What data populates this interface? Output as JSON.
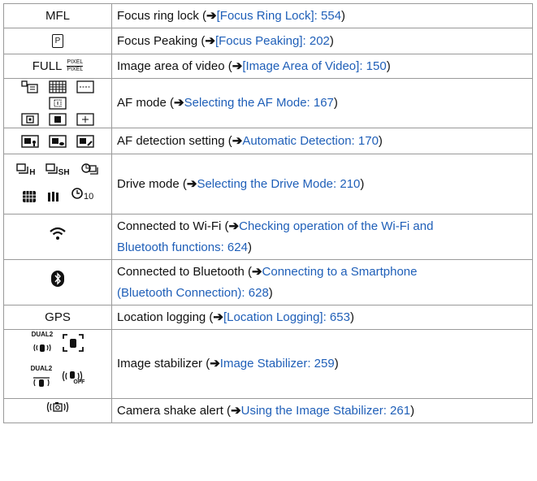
{
  "rows": [
    {
      "icon": "MFL",
      "prefix": "Focus ring lock (",
      "link": "[Focus Ring Lock]: 554",
      "suffix": ")"
    },
    {
      "icon": "P",
      "prefix": "Focus Peaking (",
      "link": "[Focus Peaking]: 202",
      "suffix": ")"
    },
    {
      "icon": "FULL",
      "icon_frac_top": "PIXEL",
      "icon_frac_bottom": "PIXEL",
      "prefix": "Image area of video (",
      "link": "[Image Area of Video]: 150",
      "suffix": ")"
    },
    {
      "prefix": "AF mode (",
      "link": "Selecting the AF Mode: 167",
      "suffix": ")"
    },
    {
      "prefix": "AF detection setting (",
      "link": "Automatic Detection: 170",
      "suffix": ")"
    },
    {
      "icon_line1": [
        "H",
        "SH",
        ""
      ],
      "icon_line2": [
        "",
        "",
        "10"
      ],
      "prefix": "Drive mode (",
      "link": "Selecting the Drive Mode: 210",
      "suffix": ")"
    },
    {
      "prefix": "Connected to Wi-Fi (",
      "link_line1": "Checking operation of the Wi-Fi and",
      "link_line2": "Bluetooth functions: 624",
      "suffix": ")"
    },
    {
      "prefix": "Connected to Bluetooth (",
      "link_line1": "Connecting to a Smartphone",
      "link_line2": "(Bluetooth Connection): 628",
      "suffix": ")"
    },
    {
      "icon": "GPS",
      "prefix": "Location logging (",
      "link": "[Location Logging]: 653",
      "suffix": ")"
    },
    {
      "icon_dual_1": "DUAL2",
      "icon_dual_2": "DUAL2",
      "icon_off": "OFF",
      "prefix": "Image stabilizer (",
      "link": "Image Stabilizer: 259",
      "suffix": ")"
    },
    {
      "prefix": "Camera shake alert (",
      "link": "Using the Image Stabilizer: 261",
      "suffix": ")"
    }
  ],
  "arrow_glyph": "➔",
  "colors": {
    "link": "#1f5fb8",
    "border": "#9a9a9a",
    "text": "#111111"
  }
}
